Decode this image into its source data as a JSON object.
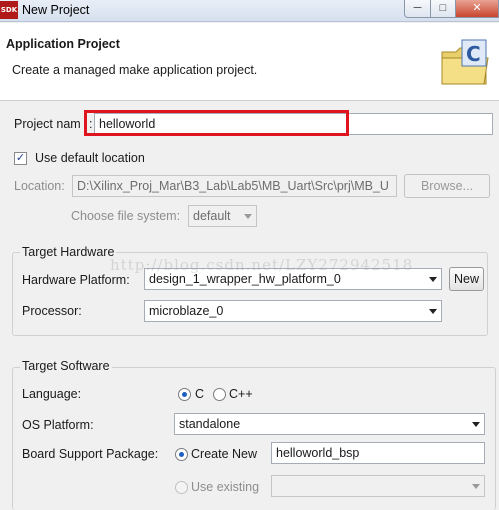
{
  "window": {
    "title": "New Project",
    "app_icon": "SDK"
  },
  "banner": {
    "title": "Application Project",
    "description": "Create a managed make application project.",
    "icon": "c-project-folder-icon"
  },
  "project_name": {
    "label": "Project nam",
    "value": "helloworld"
  },
  "default_location": {
    "label": "Use default location",
    "checked": true
  },
  "location": {
    "label": "Location:",
    "value": "D:\\Xilinx_Proj_Mar\\B3_Lab\\Lab5\\MB_Uart\\Src\\prj\\MB_U",
    "browse_label": "Browse..."
  },
  "file_system": {
    "label": "Choose file system:",
    "value": "default"
  },
  "target_hardware": {
    "title": "Target Hardware",
    "platform_label": "Hardware Platform:",
    "platform_value": "design_1_wrapper_hw_platform_0",
    "new_label": "New",
    "processor_label": "Processor:",
    "processor_value": "microblaze_0"
  },
  "target_software": {
    "title": "Target Software",
    "language_label": "Language:",
    "lang_c": "C",
    "lang_cpp": "C++",
    "os_label": "OS Platform:",
    "os_value": "standalone",
    "bsp_label": "Board Support Package:",
    "create_new_label": "Create New",
    "bsp_name": "helloworld_bsp",
    "use_existing_label": "Use existing"
  },
  "watermark": "http://blog.csdn.net/LZY272942518",
  "colors": {
    "highlight": "#e0141e",
    "radio_dot": "#1e5fbf",
    "title_close": "#c8452e"
  }
}
